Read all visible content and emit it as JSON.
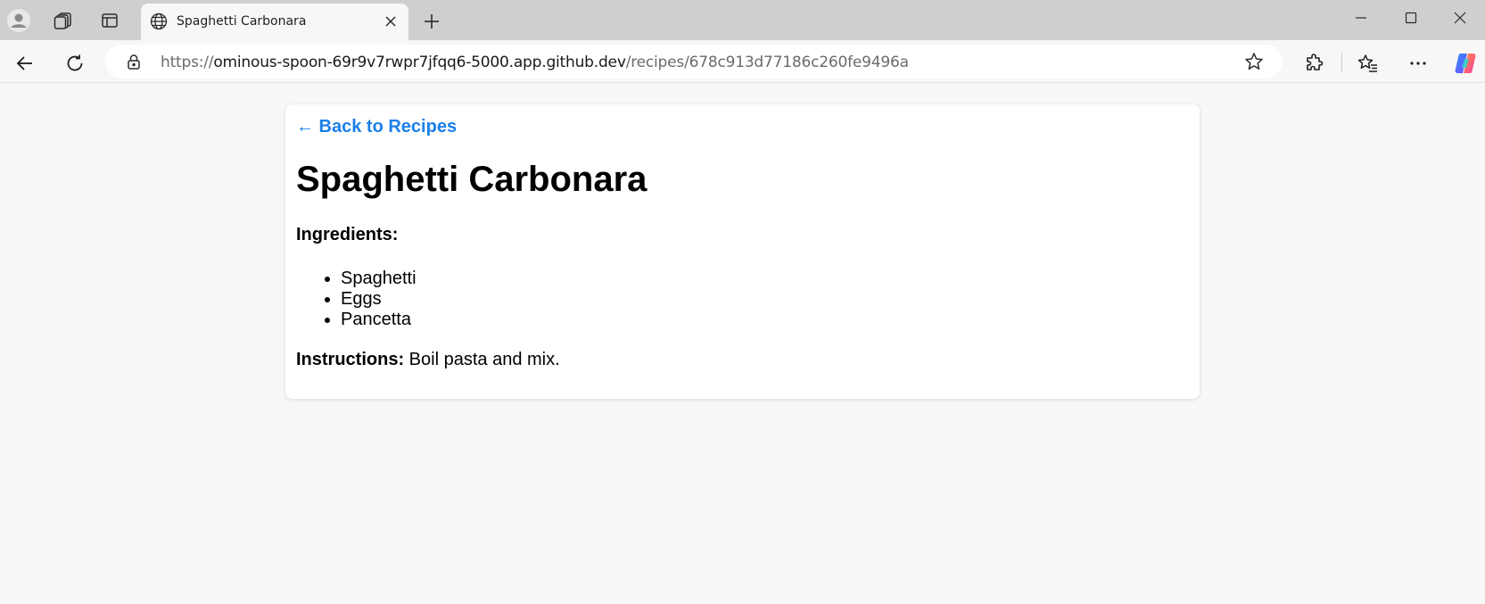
{
  "browser": {
    "tab": {
      "title": "Spaghetti Carbonara"
    },
    "address": {
      "scheme": "https://",
      "host": "ominous-spoon-69r9v7rwpr7jfqq6-5000.app.github.dev",
      "path": "/recipes/678c913d77186c260fe9496a"
    },
    "icons": [
      "profile-icon",
      "workspaces-icon",
      "tab-actions-icon",
      "globe-icon",
      "close-icon",
      "plus-icon",
      "minimize-icon",
      "maximize-icon",
      "window-close-icon",
      "back-icon",
      "refresh-icon",
      "lock-icon",
      "star-icon",
      "extensions-icon",
      "favorites-icon",
      "more-icon",
      "copilot-icon"
    ]
  },
  "page": {
    "back_link": "← Back to Recipes",
    "title": "Spaghetti Carbonara",
    "ingredients_label": "Ingredients:",
    "ingredients": [
      "Spaghetti",
      "Eggs",
      "Pancetta"
    ],
    "instructions_label": "Instructions:",
    "instructions_text": " Boil pasta and mix."
  },
  "colors": {
    "link": "#1a7fe8",
    "tabstrip": "#cfcfcf",
    "page_bg": "#f7f7f7"
  }
}
